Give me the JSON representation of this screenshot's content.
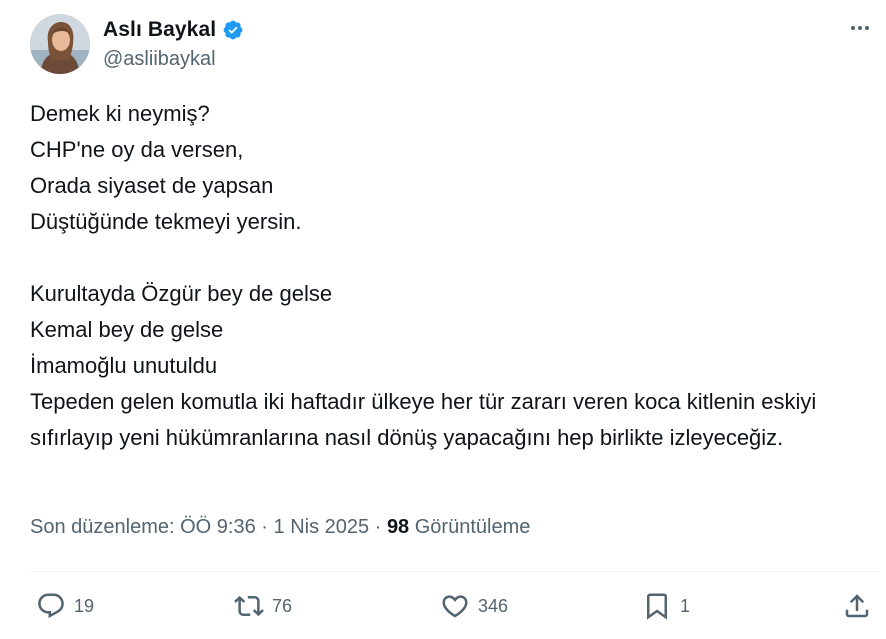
{
  "author": {
    "display_name": "Aslı Baykal",
    "handle": "@asliibaykal",
    "verified": true
  },
  "tweet": {
    "text": "Demek ki neymiş?\nCHP'ne oy da versen,\nOrada siyaset de yapsan\nDüştüğünde tekmeyi yersin.\n\nKurultayda Özgür bey de gelse\nKemal bey de gelse\nİmamoğlu unutuldu\nTepeden gelen komutla iki haftadır ülkeye her tür zararı veren koca kitlenin eskiyi sıfırlayıp yeni hükümranlarına nasıl dönüş yapacağını hep birlikte izleyeceğiz."
  },
  "meta": {
    "edited_label": "Son düzenleme:",
    "time": "ÖÖ 9:36",
    "separator": "·",
    "date": "1 Nis 2025",
    "views_count": "98",
    "views_label": "Görüntüleme"
  },
  "actions": {
    "reply_count": "19",
    "retweet_count": "76",
    "like_count": "346",
    "bookmark_count": "1"
  },
  "colors": {
    "primary_text": "#0f1419",
    "secondary_text": "#536471",
    "verified_blue": "#1d9bf0",
    "divider": "#eff3f4"
  },
  "icons": {
    "more": "more-horizontal-icon",
    "verified": "verified-badge-icon",
    "reply": "reply-icon",
    "retweet": "retweet-icon",
    "like": "heart-icon",
    "bookmark": "bookmark-icon",
    "share": "share-icon"
  }
}
